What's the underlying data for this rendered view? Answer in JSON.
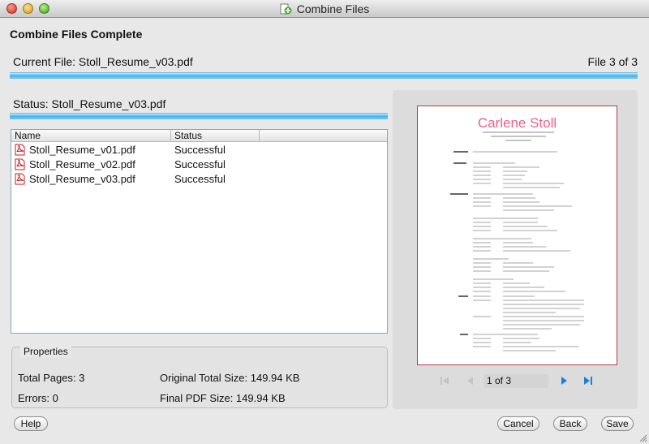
{
  "window": {
    "title": "Combine Files"
  },
  "heading": "Combine Files Complete",
  "progress": {
    "current_file_label": "Current File: Stoll_Resume_v03.pdf",
    "file_count": "File 3 of 3",
    "status_label": "Status: Stoll_Resume_v03.pdf"
  },
  "file_list": {
    "columns": [
      "Name",
      "Status"
    ],
    "rows": [
      {
        "name": "Stoll_Resume_v01.pdf",
        "status": "Successful"
      },
      {
        "name": "Stoll_Resume_v02.pdf",
        "status": "Successful"
      },
      {
        "name": "Stoll_Resume_v03.pdf",
        "status": "Successful"
      }
    ]
  },
  "properties": {
    "title": "Properties",
    "total_pages": "Total Pages: 3",
    "errors": "Errors: 0",
    "original_size": "Original Total Size: 149.94 KB",
    "final_size": "Final PDF Size: 149.94 KB"
  },
  "preview": {
    "resume_name": "Carlene Stoll",
    "page_indicator": "1 of 3"
  },
  "buttons": {
    "help": "Help",
    "cancel": "Cancel",
    "back": "Back",
    "save": "Save"
  },
  "colors": {
    "progress_blue": "#3cb4f0",
    "accent_pink": "#ec5d8f",
    "nav_blue": "#1a7fe0"
  }
}
